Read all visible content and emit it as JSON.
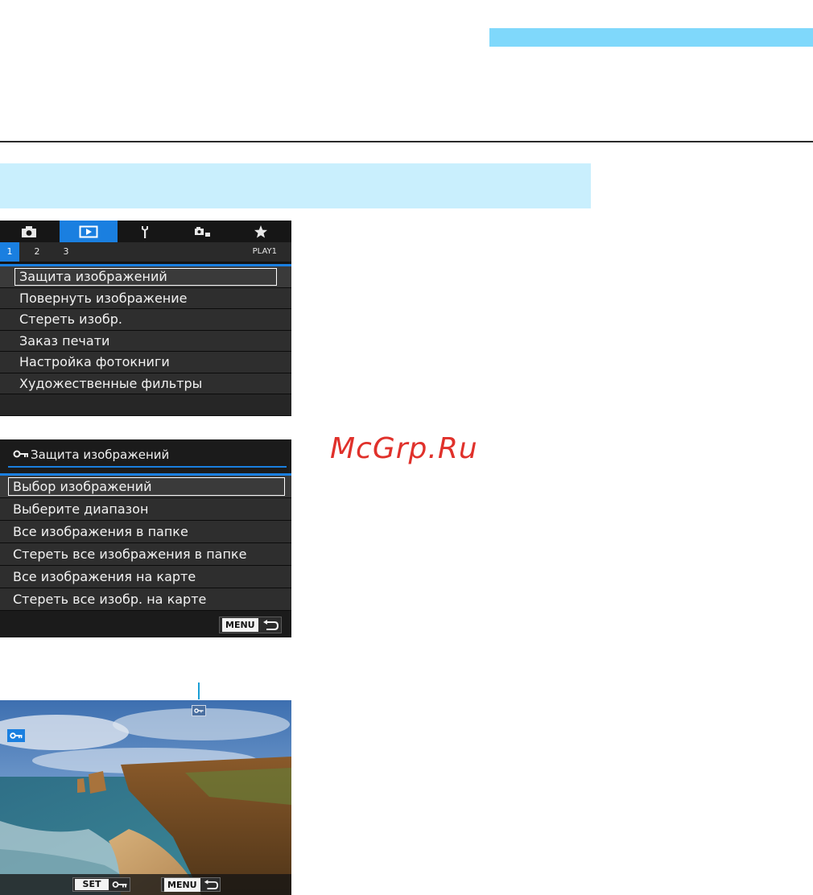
{
  "colors": {
    "accent_blue": "#1a7fe0",
    "band_blue": "#7fd8fb",
    "band_light": "#c9effd",
    "watermark_red": "#e0312b"
  },
  "screen1": {
    "tabs": [
      {
        "icon": "camera-icon"
      },
      {
        "icon": "playback-icon"
      },
      {
        "icon": "wrench-icon"
      },
      {
        "icon": "custom-functions-icon"
      },
      {
        "icon": "star-icon"
      }
    ],
    "subtabs": [
      "1",
      "2",
      "3"
    ],
    "tab_label": "PLAY1",
    "items": [
      "Защита изображений",
      "Повернуть изображение",
      "Стереть изобр.",
      "Заказ печати",
      "Настройка фотокниги",
      "Художественные фильтры"
    ]
  },
  "screen2": {
    "title": "Защита изображений",
    "items": [
      "Выбор изображений",
      "Выберите диапазон",
      "Все изображения в папке",
      "Стереть все изображения в папке",
      "Все изображения на карте",
      "Стереть все изобр. на карте"
    ],
    "menu_label": "MENU"
  },
  "watermark": "McGrp.Ru",
  "screen3": {
    "set_label": "SET",
    "menu_label": "MENU"
  }
}
